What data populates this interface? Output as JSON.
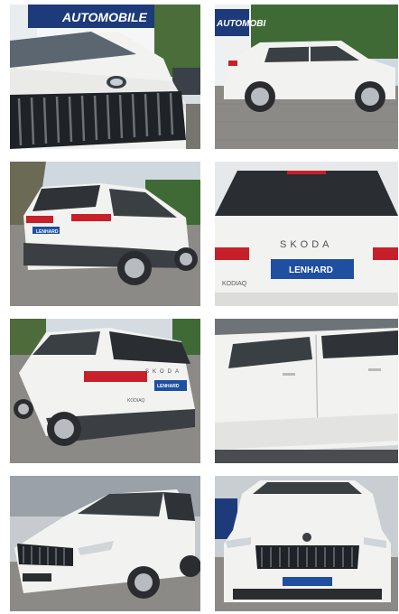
{
  "gallery": {
    "photos": [
      {
        "view": "front grille close-up with dealership sign",
        "sign_text": "AUTOMOBILE"
      },
      {
        "view": "side profile with dealership sign",
        "sign_text": "AUTOMOBI"
      },
      {
        "view": "rear three-quarter view",
        "plate_text": "LENHARD"
      },
      {
        "view": "rear close-up",
        "brand_text": "SKODA",
        "badge_text": "KODIAQ",
        "plate_text": "LENHARD"
      },
      {
        "view": "rear three-quarter view",
        "brand_text": "SKODA",
        "badge_text": "KODIAQ",
        "plate_text": "LENHARD"
      },
      {
        "view": "side doors close-up"
      },
      {
        "view": "front three-quarter view"
      },
      {
        "view": "front view"
      }
    ]
  },
  "colors": {
    "car_body": "#f2f2f0",
    "grille": "#1f2226",
    "taillight": "#c8202a",
    "sign_blue": "#1d3a7a",
    "plate_blue": "#1e4fa0",
    "pavement": "#8c8a86",
    "trees": "#3f6a35",
    "sky": "#cfd8df"
  }
}
